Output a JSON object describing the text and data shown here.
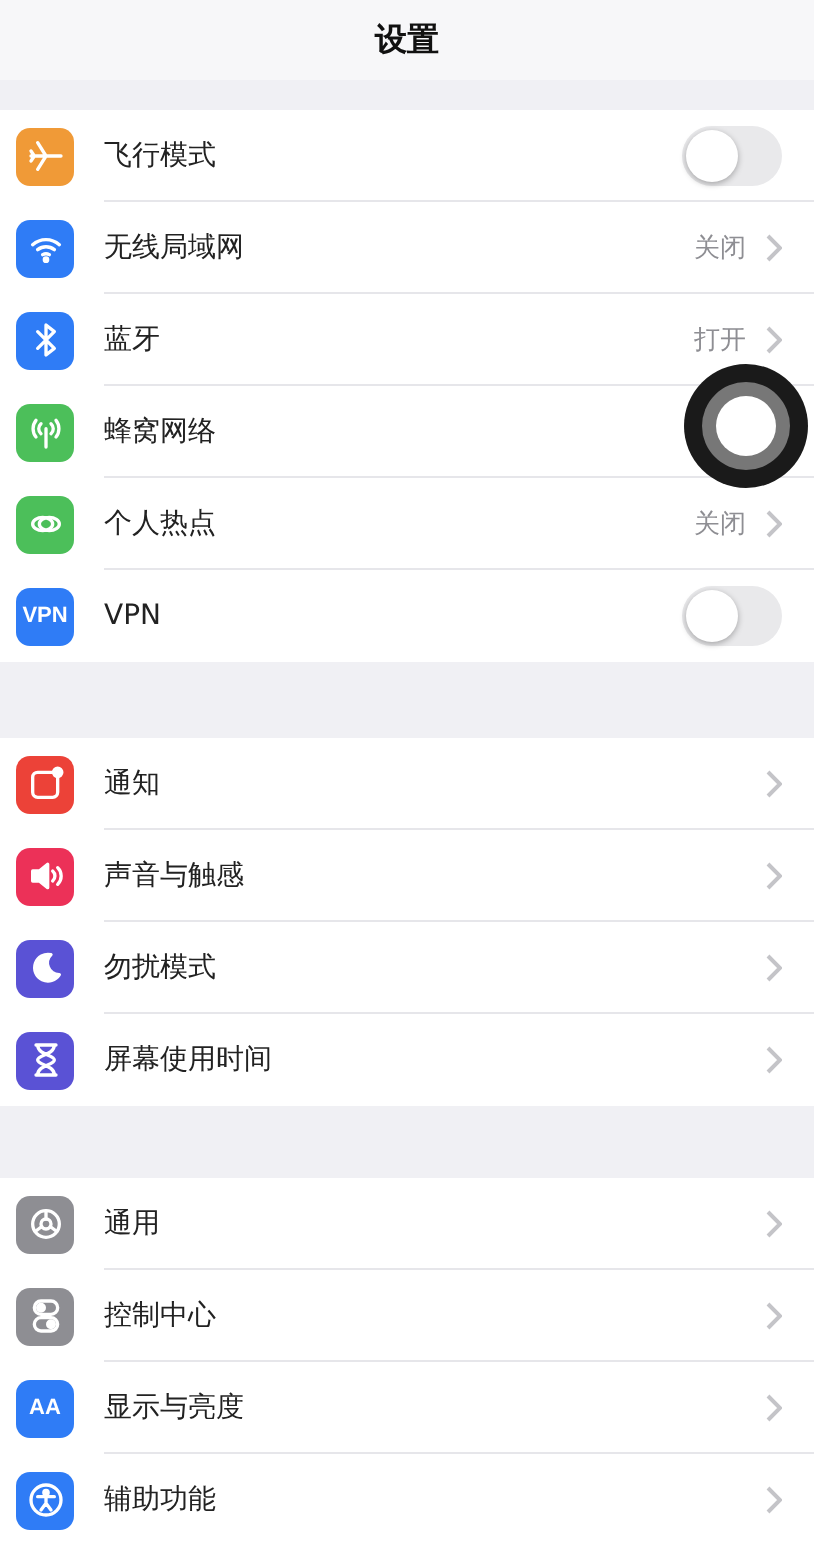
{
  "title": "设置",
  "groups": [
    {
      "rows": [
        {
          "label": "飞行模式",
          "kind": "toggle",
          "on": false,
          "color": "#f09a37"
        },
        {
          "label": "无线局域网",
          "kind": "value",
          "value": "关闭",
          "color": "#2f7cf6"
        },
        {
          "label": "蓝牙",
          "kind": "value",
          "value": "打开",
          "color": "#2f7cf6"
        },
        {
          "label": "蜂窝网络",
          "kind": "covered",
          "color": "#4cbf5a"
        },
        {
          "label": "个人热点",
          "kind": "value",
          "value": "关闭",
          "color": "#4cbf5a"
        },
        {
          "label": "VPN",
          "kind": "toggle",
          "on": false,
          "color": "#2f7cf6",
          "icon_text": "VPN"
        }
      ]
    },
    {
      "rows": [
        {
          "label": "通知",
          "kind": "link",
          "color": "#ec4238"
        },
        {
          "label": "声音与触感",
          "kind": "link",
          "color": "#ec3158"
        },
        {
          "label": "勿扰模式",
          "kind": "link",
          "color": "#5a52d5"
        },
        {
          "label": "屏幕使用时间",
          "kind": "link",
          "color": "#5a52d5"
        }
      ]
    },
    {
      "rows": [
        {
          "label": "通用",
          "kind": "link",
          "color": "#8e8e93"
        },
        {
          "label": "控制中心",
          "kind": "link",
          "color": "#8e8e93"
        },
        {
          "label": "显示与亮度",
          "kind": "link",
          "color": "#2f7cf6",
          "icon_text": "AA"
        },
        {
          "label": "辅助功能",
          "kind": "link",
          "color": "#2f7cf6"
        }
      ]
    }
  ],
  "assistive_touch": {
    "kind": "floating"
  }
}
